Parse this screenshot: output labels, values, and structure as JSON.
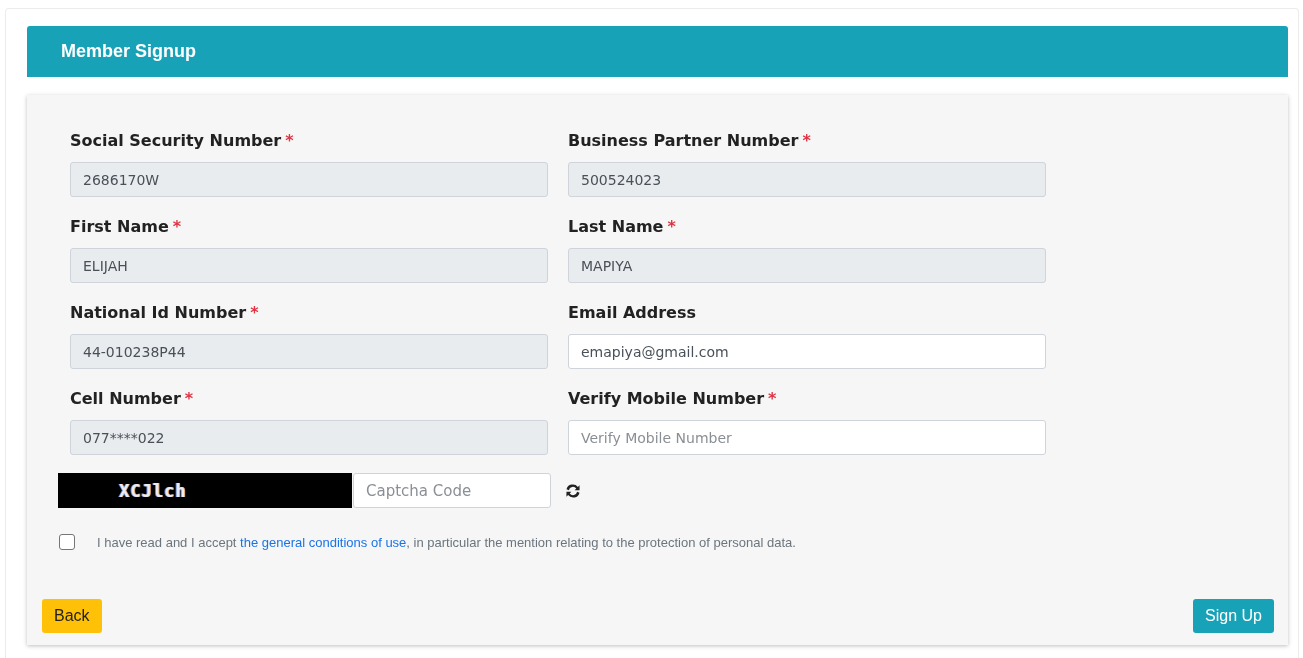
{
  "header": {
    "title": "Member Signup"
  },
  "fields": [
    {
      "label": "Social Security Number",
      "required_mark": "*",
      "value": "2686170W",
      "disabled": true
    },
    {
      "label": "Business Partner Number",
      "required_mark": "*",
      "value": "500524023",
      "disabled": true
    },
    {
      "label": "First Name",
      "required_mark": "*",
      "value": "ELIJAH",
      "disabled": true
    },
    {
      "label": "Last Name",
      "required_mark": "*",
      "value": "MAPIYA",
      "disabled": true
    },
    {
      "label": "National Id Number",
      "required_mark": "*",
      "value": "44-010238P44",
      "disabled": true
    },
    {
      "label": "Email Address",
      "value": "emapiya@gmail.com",
      "disabled": false
    },
    {
      "label": "Cell Number",
      "required_mark": "*",
      "value": "077****022",
      "disabled": true
    },
    {
      "label": "Verify Mobile Number",
      "required_mark": "*",
      "placeholder": "Verify Mobile Number",
      "disabled": false
    }
  ],
  "captcha": {
    "text": "XCJlch",
    "placeholder": "Captcha Code"
  },
  "consent": {
    "checked": false,
    "before": "I have read and I accept ",
    "link": "the general conditions of use",
    "after": ", in particular the mention relating to the protection of personal data."
  },
  "buttons": {
    "back": "Back",
    "submit": "Sign Up"
  }
}
